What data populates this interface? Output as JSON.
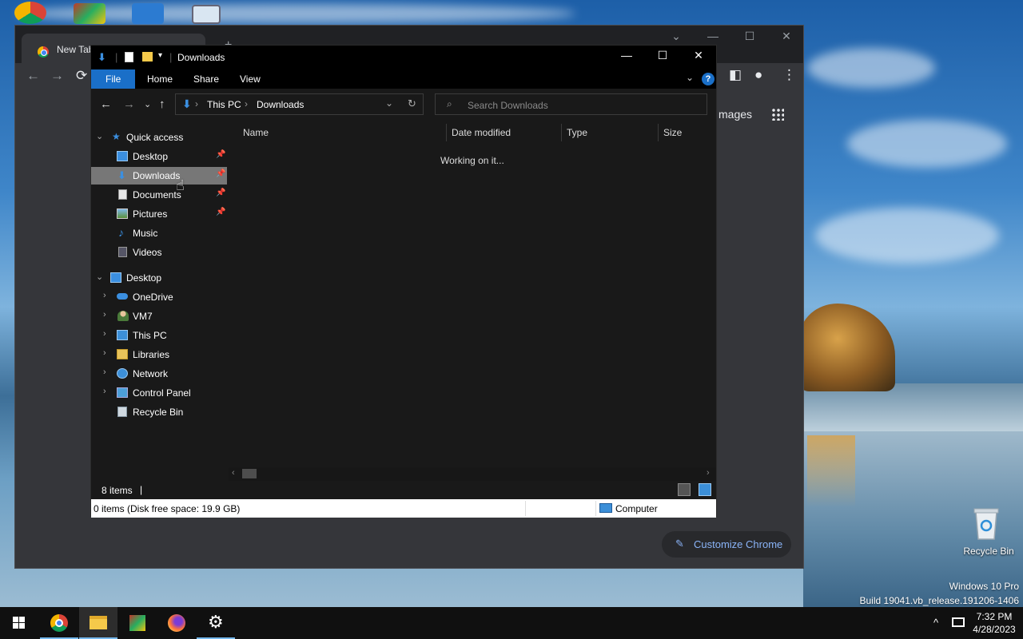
{
  "chrome": {
    "tab_title": "New Tab",
    "images_link": "mages",
    "customize_label": "Customize Chrome",
    "tab_close": "×",
    "new_tab": "+",
    "min": "—",
    "max": "☐",
    "close": "✕",
    "back": "←",
    "forward": "→",
    "reload": "⟳",
    "profile": "●",
    "menu": "⋮",
    "sidepanel": "◧",
    "tab_search": "⌄",
    "pencil": "✎"
  },
  "explorer": {
    "title": "Downloads",
    "ribbon_tabs": [
      "File",
      "Home",
      "Share",
      "View"
    ],
    "help": "?",
    "ribbon_chevron": "⌄",
    "caption": {
      "min": "—",
      "max": "☐",
      "close": "✕"
    },
    "nav": {
      "back": "←",
      "forward": "→",
      "recent": "⌄",
      "up": "↑",
      "addr_dropdown": "⌄",
      "refresh": "↻"
    },
    "address": {
      "crumbs": [
        "This PC",
        "Downloads"
      ],
      "sep": "›"
    },
    "search_placeholder": "Search Downloads",
    "search_icon": "⌕",
    "quick_access_label": "Quick access",
    "quick_access_items": [
      {
        "label": "Desktop",
        "icon": "desktop-icon",
        "pinned": true
      },
      {
        "label": "Downloads",
        "icon": "downloads-icon",
        "pinned": true,
        "selected": true
      },
      {
        "label": "Documents",
        "icon": "documents-icon",
        "pinned": true
      },
      {
        "label": "Pictures",
        "icon": "pictures-icon",
        "pinned": true
      },
      {
        "label": "Music",
        "icon": "music-icon",
        "pinned": false
      },
      {
        "label": "Videos",
        "icon": "videos-icon",
        "pinned": false
      }
    ],
    "desktop_label": "Desktop",
    "desktop_items": [
      {
        "label": "OneDrive",
        "icon": "onedrive-icon"
      },
      {
        "label": "VM7",
        "icon": "user-icon"
      },
      {
        "label": "This PC",
        "icon": "this-pc-icon"
      },
      {
        "label": "Libraries",
        "icon": "libraries-icon"
      },
      {
        "label": "Network",
        "icon": "network-icon"
      },
      {
        "label": "Control Panel",
        "icon": "control-panel-icon"
      },
      {
        "label": "Recycle Bin",
        "icon": "recycle-bin-icon"
      }
    ],
    "columns": [
      "Name",
      "Date modified",
      "Type",
      "Size"
    ],
    "status_message": "Working on it...",
    "item_count": "8 items",
    "bottom_status": "0 items (Disk free space: 19.9 GB)",
    "bottom_location": "Computer"
  },
  "desktop": {
    "recycle_bin_label": "Recycle Bin",
    "watermark_line1": "Windows 10 Pro",
    "watermark_line2": "Build 19041.vb_release.191206-1406"
  },
  "taskbar": {
    "time": "7:32 PM",
    "date": "4/28/2023",
    "tray_chevron": "^"
  },
  "colors": {
    "accent": "#1a6fc8",
    "chrome_link": "#8ab4f8",
    "selected_row": "#777777"
  }
}
